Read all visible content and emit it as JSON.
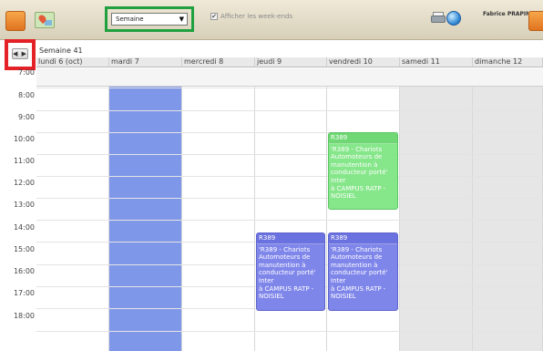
{
  "toolbar": {
    "view_select_value": "Semaine",
    "view_select_arrow": "▼",
    "weekends_label": "Afficher les week-ends",
    "weekends_checkmark": "✔",
    "user_name": "Fabrice PRAPIN",
    "icons": [
      "calendar-tab-icon",
      "map-icon",
      "printer-icon",
      "globe-icon",
      "right-tab-icon"
    ]
  },
  "calendar": {
    "nav_arrows": "◀ ▶",
    "week_title": "Semaine 41",
    "days": [
      {
        "label": "lundi 6 (oct)"
      },
      {
        "label": "mardi 7"
      },
      {
        "label": "mercredi 8"
      },
      {
        "label": "jeudi 9"
      },
      {
        "label": "vendredi 10"
      },
      {
        "label": "samedi 11"
      },
      {
        "label": "dimanche 12"
      }
    ],
    "times": [
      "7:00",
      "8:00",
      "9:00",
      "10:00",
      "11:00",
      "12:00",
      "13:00",
      "14:00",
      "15:00",
      "16:00",
      "17:00",
      "18:00"
    ],
    "events": [
      {
        "day": "vendredi 10",
        "header": "R389",
        "lines": [
          "'R389 - Chariots",
          "Automoteurs de",
          "manutention à",
          "conducteur porté'",
          "Inter",
          "à CAMPUS RATP -",
          "NOISIEL"
        ],
        "color": "#86e68a"
      },
      {
        "day": "jeudi 9",
        "header": "R389",
        "lines": [
          "'R389 - Chariots",
          "Automoteurs de",
          "manutention à",
          "conducteur porté'",
          "Inter",
          "à CAMPUS RATP -",
          "NOISIEL"
        ],
        "color": "#7f86ea"
      },
      {
        "day": "vendredi 10",
        "header": "R389",
        "lines": [
          "'R389 - Chariots",
          "Automoteurs de",
          "manutention à",
          "conducteur porté'",
          "Inter",
          "à CAMPUS RATP -",
          "NOISIEL"
        ],
        "color": "#7f86ea"
      }
    ]
  }
}
